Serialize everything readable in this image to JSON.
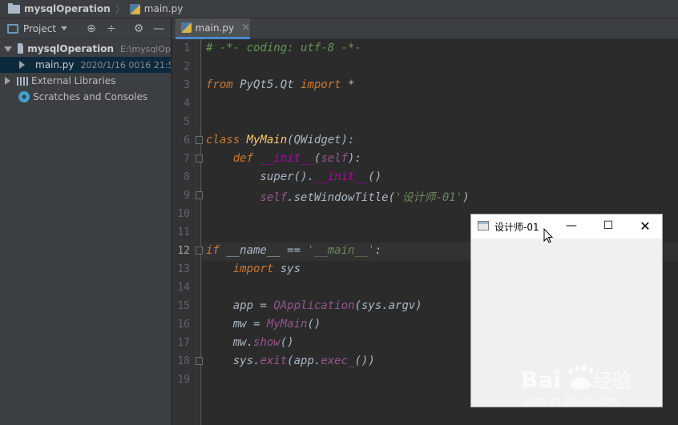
{
  "breadcrumb": {
    "project": "mysqlOperation",
    "file": "main.py"
  },
  "project_panel": {
    "title": "Project",
    "tree": [
      {
        "label": "mysqlOperation",
        "detail": "E:\\mysqlOp"
      },
      {
        "label": "main.py",
        "detail": "2020/1/16 0016 21:5"
      },
      {
        "label": "External Libraries"
      },
      {
        "label": "Scratches and Consoles"
      }
    ]
  },
  "editor": {
    "tab": {
      "label": "main.py"
    },
    "current_line": 12,
    "line_numbers": [
      "1",
      "2",
      "3",
      "4",
      "5",
      "6",
      "7",
      "8",
      "9",
      "10",
      "11",
      "12",
      "13",
      "14",
      "15",
      "16",
      "17",
      "18",
      "19"
    ]
  },
  "qt_window": {
    "title": "设计师-01",
    "minimize": "—",
    "maximize": "☐",
    "close": "✕"
  },
  "watermark": {
    "logo": "Bai du 经验",
    "url": "jingyan.baidu.com"
  },
  "colors": {
    "keyword": "#cc7832",
    "comment": "#629755",
    "string": "#6a8759",
    "function": "#ffc66d",
    "self": "#94558d",
    "magic": "#b200b2",
    "background": "#2b2b2b"
  }
}
